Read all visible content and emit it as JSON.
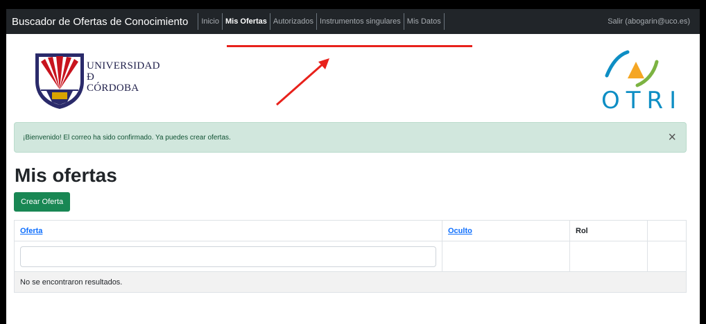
{
  "navbar": {
    "brand": "Buscador de Ofertas de Conocimiento",
    "items": [
      {
        "label": "Inicio"
      },
      {
        "label": "Mis Ofertas"
      },
      {
        "label": "Autorizados"
      },
      {
        "label": "Instrumentos singulares"
      },
      {
        "label": "Mis Datos"
      }
    ],
    "logout": "Salir (abogarin@uco.es)"
  },
  "logos": {
    "university_line1": "UNIVERSIDAD",
    "university_line2": "Ð",
    "university_line3": "CÓRDOBA",
    "otri": "OTRI"
  },
  "alert": {
    "message": "¡Bienvenido! El correo ha sido confirmado. Ya puedes crear ofertas.",
    "close": "×"
  },
  "main": {
    "title": "Mis ofertas",
    "create_button": "Crear Oferta",
    "table": {
      "columns": [
        "Oferta",
        "Oculto",
        "Rol",
        ""
      ],
      "filter_value": "",
      "empty_message": "No se encontraron resultados."
    }
  },
  "colors": {
    "navbar": "#212529",
    "success": "#198754",
    "alert_bg": "#d1e7dd",
    "annotation": "#e8211b"
  }
}
